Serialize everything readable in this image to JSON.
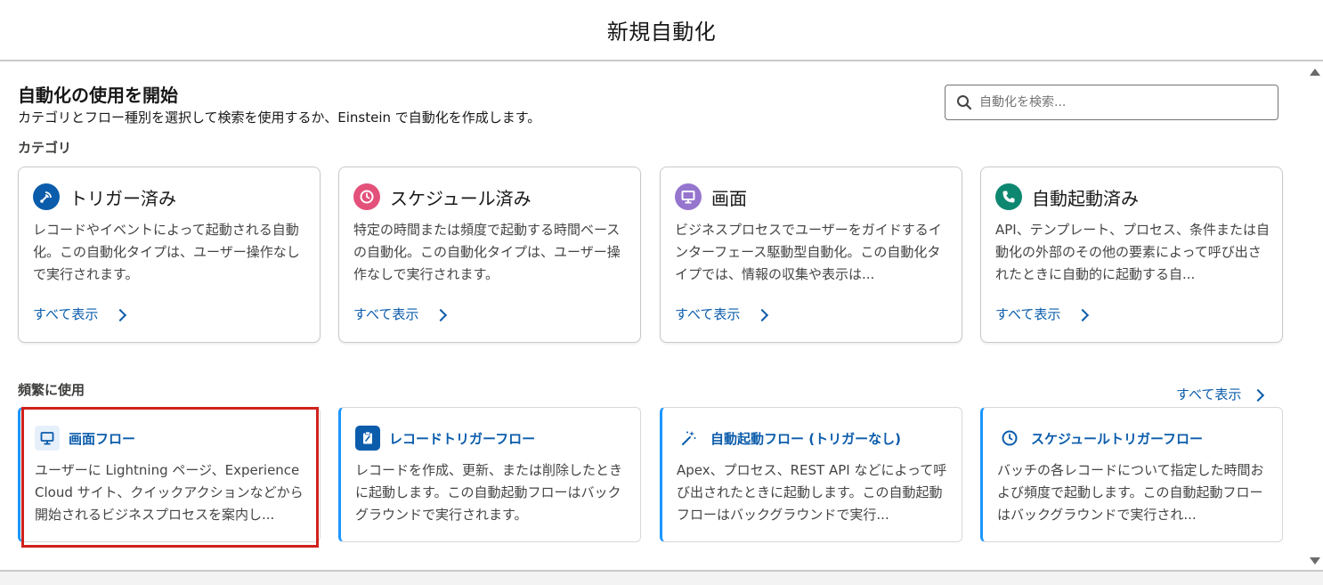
{
  "modal": {
    "title": "新規自動化"
  },
  "intro": {
    "heading": "自動化の使用を開始",
    "subtitle": "カテゴリとフロー種別を選択して検索を使用するか、Einstein で自動化を作成します。"
  },
  "search": {
    "placeholder": "自動化を検索..."
  },
  "categories": {
    "label": "カテゴリ",
    "items": [
      {
        "title": "トリガー済み",
        "desc": "レコードやイベントによって起動される自動化。この自動化タイプは、ユーザー操作なしで実行されます。",
        "link": "すべて表示",
        "color": "#0b5cab",
        "icon": "trigger-icon"
      },
      {
        "title": "スケジュール済み",
        "desc": "特定の時間または頻度で起動する時間ベースの自動化。この自動化タイプは、ユーザー操作なしで実行されます。",
        "link": "すべて表示",
        "color": "#e3517b",
        "icon": "clock-icon"
      },
      {
        "title": "画面",
        "desc": "ビジネスプロセスでユーザーをガイドするインターフェース駆動型自動化。この自動化タイプでは、情報の収集や表示は...",
        "link": "すべて表示",
        "color": "#9575cd",
        "icon": "screen-icon"
      },
      {
        "title": "自動起動済み",
        "desc": "API、テンプレート、プロセス、条件または自動化の外部のその他の要素によって呼び出されたときに自動的に起動する自...",
        "link": "すべて表示",
        "color": "#0e8770",
        "icon": "phone-icon"
      }
    ]
  },
  "frequent": {
    "label": "頻繁に使用",
    "view_all": "すべて表示",
    "items": [
      {
        "title": "画面フロー",
        "desc": "ユーザーに Lightning ページ、Experience Cloud サイト、クイックアクションなどから開始されるビジネスプロセスを案内し...",
        "icon": "monitor-icon",
        "icon_bg": "#e6f0fb",
        "icon_color": "#0b5cab"
      },
      {
        "title": "レコードトリガーフロー",
        "desc": "レコードを作成、更新、または削除したときに起動します。この自動起動フローはバックグラウンドで実行されます。",
        "icon": "clipboard-icon",
        "icon_bg": "#0b5cab",
        "icon_color": "#ffffff"
      },
      {
        "title": "自動起動フロー (トリガーなし)",
        "desc": "Apex、プロセス、REST API などによって呼び出されたときに起動します。この自動起動フローはバックグラウンドで実行...",
        "icon": "magic-wand-icon",
        "icon_bg": "#ffffff",
        "icon_color": "#0b5cab"
      },
      {
        "title": "スケジュールトリガーフロー",
        "desc": "バッチの各レコードについて指定した時間および頻度で起動します。この自動起動フローはバックグラウンドで実行され...",
        "icon": "clock-icon",
        "icon_bg": "#ffffff",
        "icon_color": "#0b5cab"
      }
    ]
  }
}
